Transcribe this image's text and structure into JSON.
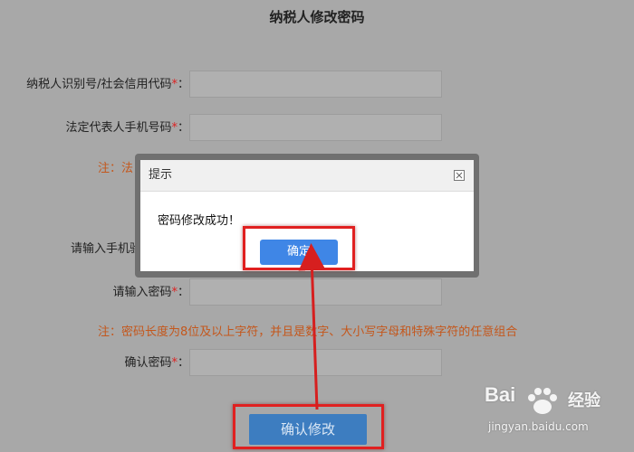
{
  "page": {
    "title": "纳税人修改密码"
  },
  "form": {
    "taxpayer_id_label": "纳税人识别号/社会信用代码",
    "phone_label": "法定代表人手机号码",
    "phone_note_partial": "注：法",
    "sms_code_label_partial": "请输入手机验",
    "password_label": "请输入密码",
    "password_note": "注：密码长度为8位及以上字符，并且是数字、大小写字母和特殊字符的任意组合",
    "confirm_label": "确认密码",
    "required_mark": "*",
    "colon": "：",
    "submit_label": "确认修改"
  },
  "dialog": {
    "title": "提示",
    "message": "密码修改成功！",
    "ok_label": "确定"
  },
  "watermark": {
    "brand": "Bai",
    "brand_suffix": "经验",
    "url": "jingyan.baidu.com"
  },
  "colors": {
    "background": "#a8a8a8",
    "note": "#c4571c",
    "required": "#d22222",
    "button": "#3f86e6",
    "highlight": "#e02020"
  }
}
